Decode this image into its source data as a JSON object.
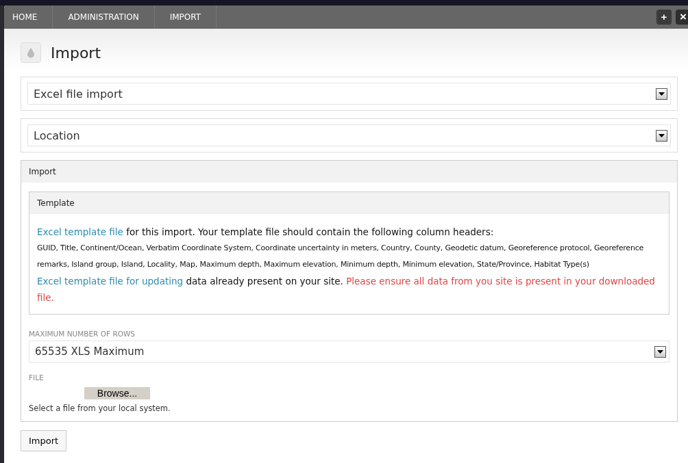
{
  "breadcrumbs": [
    {
      "label": "HOME"
    },
    {
      "label": "ADMINISTRATION"
    },
    {
      "label": "IMPORT"
    }
  ],
  "window_buttons": [
    {
      "kind": "add",
      "label": "+"
    },
    {
      "kind": "close",
      "label": "×"
    }
  ],
  "page": {
    "title": "Import"
  },
  "selects": [
    {
      "value": "Excel file import"
    },
    {
      "value": "Location"
    }
  ],
  "import_section": {
    "title": "Import",
    "template": {
      "title": "Template",
      "line_1": {
        "link": "Excel template file",
        "text": " for this import. Your template file should contain the following column headers:"
      },
      "columns": "GUID, Title, Continent/Ocean, Verbatim Coordinate System, Coordinate uncertainty in meters, Country, County, Geodetic datum, Georeference protocol, Georeference remarks, Island group, Island, Locality, Map, Maximum depth, Maximum elevation, Minimum depth, Minimum elevation, State/Province, Habitat Type(s)",
      "line_2": {
        "link": "Excel template file for updating",
        "text": " data already present on your site. ",
        "warning": "Please ensure all data from you site is present in your downloaded file."
      }
    },
    "max_rows": {
      "label": "MAXIMUM NUMBER OF ROWS",
      "value": "65535 XLS Maximum"
    },
    "file": {
      "label": "FILE",
      "button": "Browse...",
      "hint": "Select a file from your local system."
    }
  },
  "submit": "Import"
}
